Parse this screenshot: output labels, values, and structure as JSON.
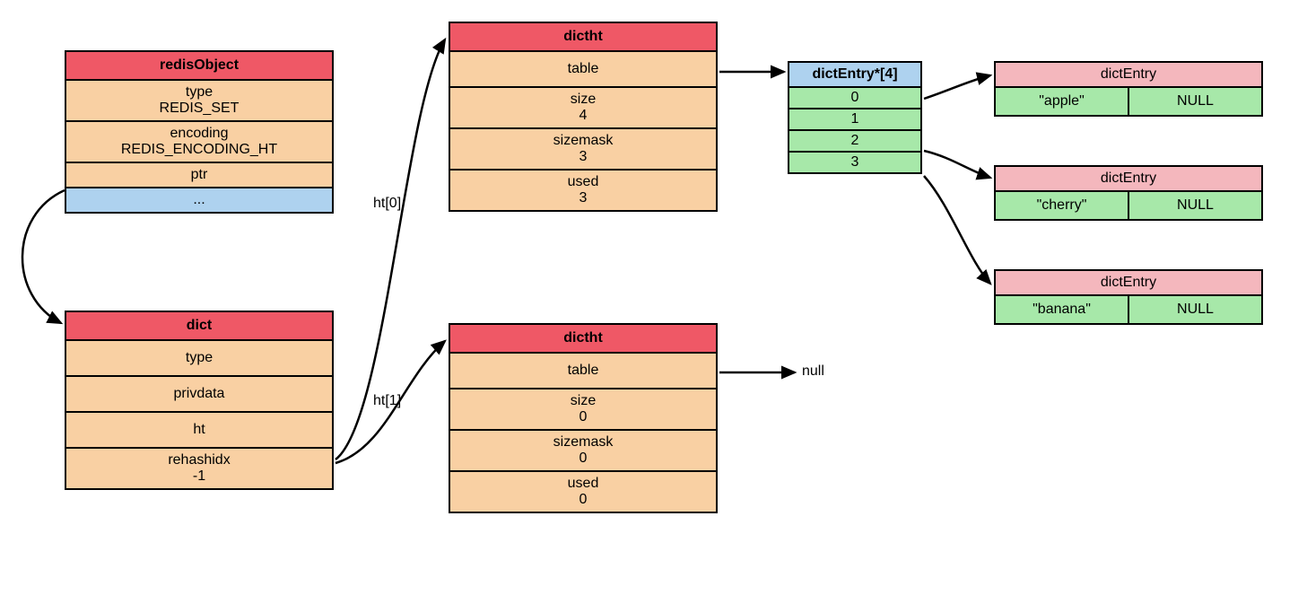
{
  "redisObject": {
    "title": "redisObject",
    "type_label": "type",
    "type_value": "REDIS_SET",
    "encoding_label": "encoding",
    "encoding_value": "REDIS_ENCODING_HT",
    "ptr_label": "ptr",
    "rest_label": "..."
  },
  "dict": {
    "title": "dict",
    "type_label": "type",
    "privdata_label": "privdata",
    "ht_label": "ht",
    "rehashidx_label": "rehashidx",
    "rehashidx_value": "-1"
  },
  "dictht0": {
    "title": "dictht",
    "table_label": "table",
    "size_label": "size",
    "size_value": "4",
    "sizemask_label": "sizemask",
    "sizemask_value": "3",
    "used_label": "used",
    "used_value": "3"
  },
  "dictht1": {
    "title": "dictht",
    "table_label": "table",
    "size_label": "size",
    "size_value": "0",
    "sizemask_label": "sizemask",
    "sizemask_value": "0",
    "used_label": "used",
    "used_value": "0"
  },
  "entryArray": {
    "title": "dictEntry*[4]",
    "slots": [
      "0",
      "1",
      "2",
      "3"
    ]
  },
  "entries": {
    "e0": {
      "title": "dictEntry",
      "key": "\"apple\"",
      "next": "NULL"
    },
    "e1": {
      "title": "dictEntry",
      "key": "\"cherry\"",
      "next": "NULL"
    },
    "e2": {
      "title": "dictEntry",
      "key": "\"banana\"",
      "next": "NULL"
    }
  },
  "labels": {
    "ht0": "ht[0]",
    "ht1": "ht[1]",
    "null": "null"
  }
}
